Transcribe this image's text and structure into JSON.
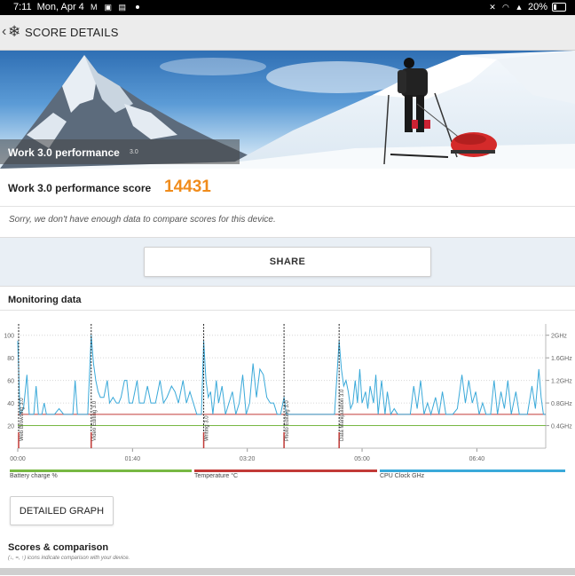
{
  "status": {
    "time": "7:11",
    "date": "Mon, Apr 4",
    "battery": "20%"
  },
  "appbar": {
    "title": "SCORE DETAILS",
    "icon": "snowflake-icon"
  },
  "hero": {
    "benchmark": "Work 3.0 performance",
    "version": "3.0"
  },
  "score": {
    "label": "Work 3.0 performance score",
    "value": "14431",
    "value_color": "#f08c1c",
    "message": "Sorry, we don't have enough data to compare scores for this device."
  },
  "share": {
    "label": "SHARE"
  },
  "monitoring": {
    "title": "Monitoring data",
    "legend": [
      {
        "label": "Battery charge %",
        "color": "#77b843"
      },
      {
        "label": "Temperature °C",
        "color": "#c23a37"
      },
      {
        "label": "CPU Clock GHz",
        "color": "#3aa9d9"
      }
    ]
  },
  "chart_data": {
    "type": "line",
    "xlabel": "",
    "ylabel": "",
    "x_ticks": [
      "00:00",
      "01:40",
      "03:20",
      "05:00",
      "06:40"
    ],
    "y_left_ticks": [
      "20",
      "40",
      "60",
      "80",
      "100"
    ],
    "y_left_range": [
      0,
      110
    ],
    "y_right_ticks": [
      "0.4GHz",
      "0.8GHz",
      "1.2GHz",
      "1.6GHz",
      "2GHz"
    ],
    "y_right_range": [
      0,
      2.2
    ],
    "x_range_seconds": [
      0,
      460
    ],
    "segments": [
      {
        "label": "Web Browsing 3.0",
        "start": 0
      },
      {
        "label": "Video Editing 3.0",
        "start": 64
      },
      {
        "label": "Writing 3.0",
        "start": 162
      },
      {
        "label": "Photo Editing 3.0",
        "start": 232
      },
      {
        "label": "Data Manipulation 3.0",
        "start": 280
      }
    ],
    "series": [
      {
        "name": "Battery charge %",
        "values": [
          [
            0,
            20
          ],
          [
            460,
            20
          ]
        ]
      },
      {
        "name": "Temperature °C",
        "values": [
          [
            0,
            30
          ],
          [
            460,
            30
          ]
        ]
      },
      {
        "name": "CPU Clock GHz",
        "values": [
          [
            0,
            1.9
          ],
          [
            2,
            0.6
          ],
          [
            5,
            0.7
          ],
          [
            8,
            1.3
          ],
          [
            10,
            0.6
          ],
          [
            14,
            0.6
          ],
          [
            16,
            1.1
          ],
          [
            18,
            0.6
          ],
          [
            21,
            0.6
          ],
          [
            23,
            0.8
          ],
          [
            25,
            0.6
          ],
          [
            28,
            0.6
          ],
          [
            32,
            0.6
          ],
          [
            36,
            0.7
          ],
          [
            40,
            0.6
          ],
          [
            45,
            0.6
          ],
          [
            48,
            0.6
          ],
          [
            50,
            1.2
          ],
          [
            52,
            0.6
          ],
          [
            55,
            0.6
          ],
          [
            58,
            0.6
          ],
          [
            61,
            0.6
          ],
          [
            64,
            2.0
          ],
          [
            66,
            1.5
          ],
          [
            68,
            1.2
          ],
          [
            70,
            1.0
          ],
          [
            72,
            0.9
          ],
          [
            75,
            0.9
          ],
          [
            78,
            1.2
          ],
          [
            80,
            0.8
          ],
          [
            83,
            0.9
          ],
          [
            86,
            0.8
          ],
          [
            88,
            0.8
          ],
          [
            90,
            0.9
          ],
          [
            93,
            1.2
          ],
          [
            95,
            1.2
          ],
          [
            97,
            0.8
          ],
          [
            100,
            0.8
          ],
          [
            104,
            1.2
          ],
          [
            106,
            0.8
          ],
          [
            110,
            0.8
          ],
          [
            113,
            1.1
          ],
          [
            116,
            0.8
          ],
          [
            120,
            0.8
          ],
          [
            124,
            1.2
          ],
          [
            127,
            0.8
          ],
          [
            130,
            0.9
          ],
          [
            134,
            1.1
          ],
          [
            137,
            1.0
          ],
          [
            140,
            0.8
          ],
          [
            144,
            1.2
          ],
          [
            147,
            0.8
          ],
          [
            150,
            1.0
          ],
          [
            153,
            0.8
          ],
          [
            156,
            0.6
          ],
          [
            160,
            0.6
          ],
          [
            162,
            1.9
          ],
          [
            164,
            1.2
          ],
          [
            166,
            0.9
          ],
          [
            168,
            1.0
          ],
          [
            170,
            0.6
          ],
          [
            173,
            1.2
          ],
          [
            175,
            0.8
          ],
          [
            178,
            1.1
          ],
          [
            181,
            0.6
          ],
          [
            184,
            0.8
          ],
          [
            187,
            1.0
          ],
          [
            190,
            0.6
          ],
          [
            193,
            0.8
          ],
          [
            196,
            1.3
          ],
          [
            199,
            0.6
          ],
          [
            202,
            0.8
          ],
          [
            205,
            1.5
          ],
          [
            208,
            0.9
          ],
          [
            211,
            1.4
          ],
          [
            214,
            1.3
          ],
          [
            217,
            0.9
          ],
          [
            220,
            0.8
          ],
          [
            223,
            0.8
          ],
          [
            226,
            0.6
          ],
          [
            229,
            0.6
          ],
          [
            232,
            0.9
          ],
          [
            234,
            0.6
          ],
          [
            236,
            0.6
          ],
          [
            240,
            0.6
          ],
          [
            244,
            0.6
          ],
          [
            248,
            0.6
          ],
          [
            252,
            0.6
          ],
          [
            256,
            0.6
          ],
          [
            260,
            0.6
          ],
          [
            264,
            0.6
          ],
          [
            268,
            0.6
          ],
          [
            272,
            0.6
          ],
          [
            276,
            0.6
          ],
          [
            280,
            1.9
          ],
          [
            282,
            1.4
          ],
          [
            284,
            1.1
          ],
          [
            286,
            1.2
          ],
          [
            288,
            1.0
          ],
          [
            290,
            0.7
          ],
          [
            292,
            0.8
          ],
          [
            294,
            1.2
          ],
          [
            296,
            0.8
          ],
          [
            298,
            1.4
          ],
          [
            300,
            0.8
          ],
          [
            303,
            1.0
          ],
          [
            305,
            0.7
          ],
          [
            307,
            1.1
          ],
          [
            310,
            0.8
          ],
          [
            312,
            1.3
          ],
          [
            314,
            0.6
          ],
          [
            317,
            1.2
          ],
          [
            320,
            0.6
          ],
          [
            322,
            1.0
          ],
          [
            325,
            0.6
          ],
          [
            328,
            0.7
          ],
          [
            331,
            0.6
          ],
          [
            334,
            0.6
          ],
          [
            338,
            0.6
          ],
          [
            342,
            0.6
          ],
          [
            345,
            1.1
          ],
          [
            348,
            0.7
          ],
          [
            351,
            1.2
          ],
          [
            354,
            0.6
          ],
          [
            357,
            0.8
          ],
          [
            360,
            0.6
          ],
          [
            364,
            0.9
          ],
          [
            367,
            0.6
          ],
          [
            370,
            1.0
          ],
          [
            373,
            0.6
          ],
          [
            376,
            0.6
          ],
          [
            379,
            0.6
          ],
          [
            383,
            0.7
          ],
          [
            387,
            1.3
          ],
          [
            390,
            0.8
          ],
          [
            393,
            1.2
          ],
          [
            396,
            0.8
          ],
          [
            399,
            1.0
          ],
          [
            402,
            0.6
          ],
          [
            405,
            0.8
          ],
          [
            408,
            0.6
          ],
          [
            412,
            0.6
          ],
          [
            415,
            1.2
          ],
          [
            418,
            0.6
          ],
          [
            421,
            1.0
          ],
          [
            424,
            0.7
          ],
          [
            427,
            1.2
          ],
          [
            430,
            0.6
          ],
          [
            434,
            1.0
          ],
          [
            437,
            0.6
          ],
          [
            440,
            0.6
          ],
          [
            444,
            0.6
          ],
          [
            448,
            1.1
          ],
          [
            451,
            0.7
          ],
          [
            454,
            1.4
          ],
          [
            456,
            0.9
          ],
          [
            458,
            0.6
          ],
          [
            460,
            0.6
          ]
        ]
      }
    ]
  },
  "detailed_graph": {
    "label": "DETAILED GRAPH"
  },
  "scores": {
    "title": "Scores & comparison",
    "subtitle": "(↓, =, ↑) icons indicate comparison with your device."
  }
}
